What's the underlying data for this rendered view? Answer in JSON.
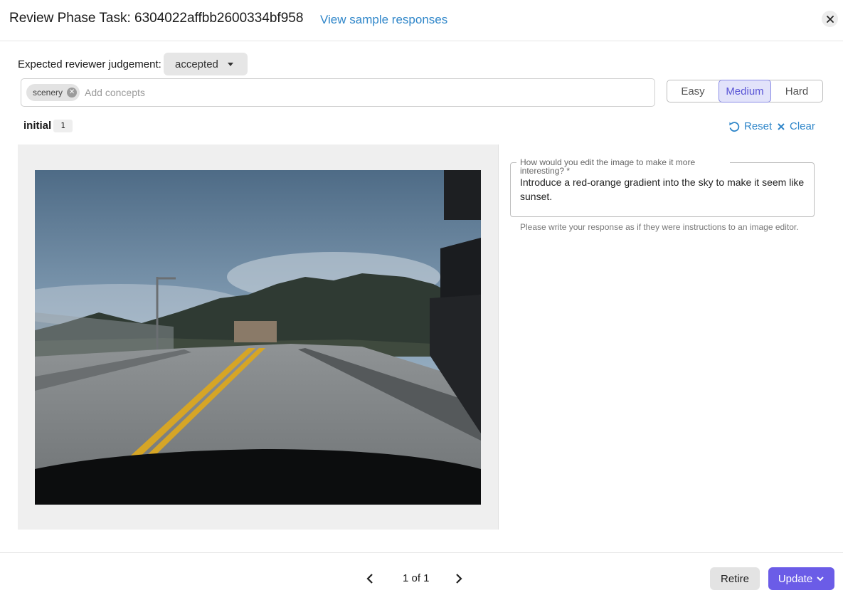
{
  "header": {
    "title": "Review Phase Task: 6304022affbb2600334bf958",
    "sample_link": "View sample responses"
  },
  "judgement": {
    "label": "Expected reviewer judgement:",
    "selected": "accepted"
  },
  "concepts": {
    "chips": [
      "scenery"
    ],
    "placeholder": "Add concepts"
  },
  "difficulty": {
    "options": [
      "Easy",
      "Medium",
      "Hard"
    ],
    "selected": "Medium"
  },
  "section": {
    "label": "initial",
    "count": "1"
  },
  "actions": {
    "reset": "Reset",
    "clear": "Clear"
  },
  "response": {
    "question": "How would you edit the image to make it more interesting? *",
    "answer": "Introduce a red-orange gradient into the sky to make it seem like sunset.",
    "helper": "Please write your response as if they were instructions to an image editor."
  },
  "pager": {
    "text": "1 of 1"
  },
  "footer": {
    "retire": "Retire",
    "update": "Update"
  },
  "colors": {
    "link": "#2f86c9",
    "primary": "#6b5ce7",
    "selected_bg": "#e2e3fa"
  }
}
